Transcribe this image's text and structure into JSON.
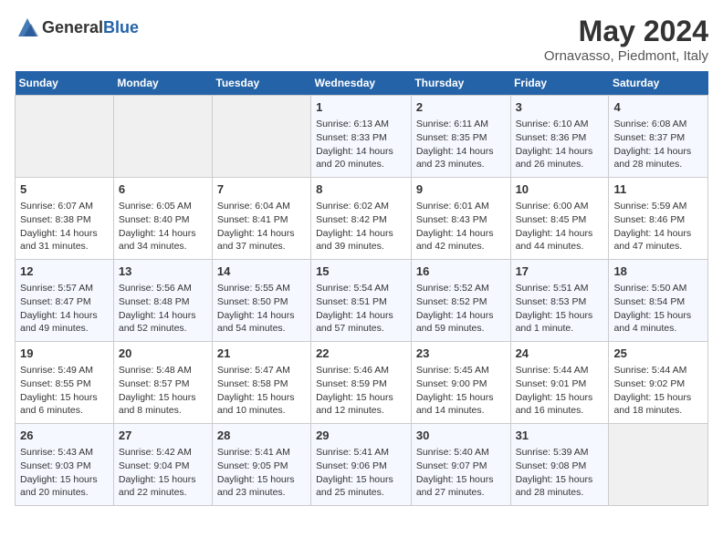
{
  "header": {
    "logo_general": "General",
    "logo_blue": "Blue",
    "month_year": "May 2024",
    "location": "Ornavasso, Piedmont, Italy"
  },
  "weekdays": [
    "Sunday",
    "Monday",
    "Tuesday",
    "Wednesday",
    "Thursday",
    "Friday",
    "Saturday"
  ],
  "weeks": [
    [
      {
        "day": "",
        "info": ""
      },
      {
        "day": "",
        "info": ""
      },
      {
        "day": "",
        "info": ""
      },
      {
        "day": "1",
        "info": "Sunrise: 6:13 AM\nSunset: 8:33 PM\nDaylight: 14 hours\nand 20 minutes."
      },
      {
        "day": "2",
        "info": "Sunrise: 6:11 AM\nSunset: 8:35 PM\nDaylight: 14 hours\nand 23 minutes."
      },
      {
        "day": "3",
        "info": "Sunrise: 6:10 AM\nSunset: 8:36 PM\nDaylight: 14 hours\nand 26 minutes."
      },
      {
        "day": "4",
        "info": "Sunrise: 6:08 AM\nSunset: 8:37 PM\nDaylight: 14 hours\nand 28 minutes."
      }
    ],
    [
      {
        "day": "5",
        "info": "Sunrise: 6:07 AM\nSunset: 8:38 PM\nDaylight: 14 hours\nand 31 minutes."
      },
      {
        "day": "6",
        "info": "Sunrise: 6:05 AM\nSunset: 8:40 PM\nDaylight: 14 hours\nand 34 minutes."
      },
      {
        "day": "7",
        "info": "Sunrise: 6:04 AM\nSunset: 8:41 PM\nDaylight: 14 hours\nand 37 minutes."
      },
      {
        "day": "8",
        "info": "Sunrise: 6:02 AM\nSunset: 8:42 PM\nDaylight: 14 hours\nand 39 minutes."
      },
      {
        "day": "9",
        "info": "Sunrise: 6:01 AM\nSunset: 8:43 PM\nDaylight: 14 hours\nand 42 minutes."
      },
      {
        "day": "10",
        "info": "Sunrise: 6:00 AM\nSunset: 8:45 PM\nDaylight: 14 hours\nand 44 minutes."
      },
      {
        "day": "11",
        "info": "Sunrise: 5:59 AM\nSunset: 8:46 PM\nDaylight: 14 hours\nand 47 minutes."
      }
    ],
    [
      {
        "day": "12",
        "info": "Sunrise: 5:57 AM\nSunset: 8:47 PM\nDaylight: 14 hours\nand 49 minutes."
      },
      {
        "day": "13",
        "info": "Sunrise: 5:56 AM\nSunset: 8:48 PM\nDaylight: 14 hours\nand 52 minutes."
      },
      {
        "day": "14",
        "info": "Sunrise: 5:55 AM\nSunset: 8:50 PM\nDaylight: 14 hours\nand 54 minutes."
      },
      {
        "day": "15",
        "info": "Sunrise: 5:54 AM\nSunset: 8:51 PM\nDaylight: 14 hours\nand 57 minutes."
      },
      {
        "day": "16",
        "info": "Sunrise: 5:52 AM\nSunset: 8:52 PM\nDaylight: 14 hours\nand 59 minutes."
      },
      {
        "day": "17",
        "info": "Sunrise: 5:51 AM\nSunset: 8:53 PM\nDaylight: 15 hours\nand 1 minute."
      },
      {
        "day": "18",
        "info": "Sunrise: 5:50 AM\nSunset: 8:54 PM\nDaylight: 15 hours\nand 4 minutes."
      }
    ],
    [
      {
        "day": "19",
        "info": "Sunrise: 5:49 AM\nSunset: 8:55 PM\nDaylight: 15 hours\nand 6 minutes."
      },
      {
        "day": "20",
        "info": "Sunrise: 5:48 AM\nSunset: 8:57 PM\nDaylight: 15 hours\nand 8 minutes."
      },
      {
        "day": "21",
        "info": "Sunrise: 5:47 AM\nSunset: 8:58 PM\nDaylight: 15 hours\nand 10 minutes."
      },
      {
        "day": "22",
        "info": "Sunrise: 5:46 AM\nSunset: 8:59 PM\nDaylight: 15 hours\nand 12 minutes."
      },
      {
        "day": "23",
        "info": "Sunrise: 5:45 AM\nSunset: 9:00 PM\nDaylight: 15 hours\nand 14 minutes."
      },
      {
        "day": "24",
        "info": "Sunrise: 5:44 AM\nSunset: 9:01 PM\nDaylight: 15 hours\nand 16 minutes."
      },
      {
        "day": "25",
        "info": "Sunrise: 5:44 AM\nSunset: 9:02 PM\nDaylight: 15 hours\nand 18 minutes."
      }
    ],
    [
      {
        "day": "26",
        "info": "Sunrise: 5:43 AM\nSunset: 9:03 PM\nDaylight: 15 hours\nand 20 minutes."
      },
      {
        "day": "27",
        "info": "Sunrise: 5:42 AM\nSunset: 9:04 PM\nDaylight: 15 hours\nand 22 minutes."
      },
      {
        "day": "28",
        "info": "Sunrise: 5:41 AM\nSunset: 9:05 PM\nDaylight: 15 hours\nand 23 minutes."
      },
      {
        "day": "29",
        "info": "Sunrise: 5:41 AM\nSunset: 9:06 PM\nDaylight: 15 hours\nand 25 minutes."
      },
      {
        "day": "30",
        "info": "Sunrise: 5:40 AM\nSunset: 9:07 PM\nDaylight: 15 hours\nand 27 minutes."
      },
      {
        "day": "31",
        "info": "Sunrise: 5:39 AM\nSunset: 9:08 PM\nDaylight: 15 hours\nand 28 minutes."
      },
      {
        "day": "",
        "info": ""
      }
    ]
  ]
}
